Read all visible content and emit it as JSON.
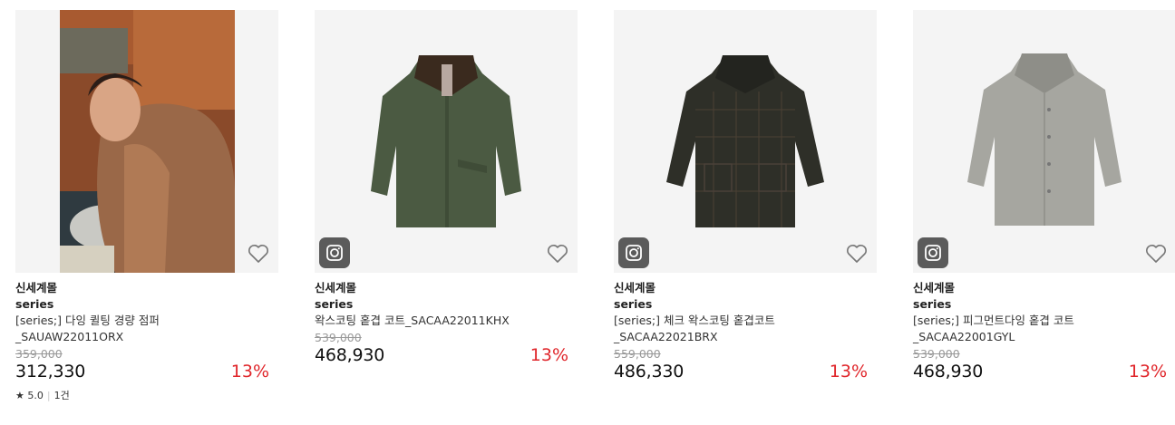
{
  "colors": {
    "discount": "#e0262b",
    "insta_badge": "#5b5b5b",
    "thumb_bg": "#f4f4f4"
  },
  "products": [
    {
      "store": "신세계몰",
      "brand": "series",
      "name_line1": "[series;] 다잉 퀼팅 경량 점퍼",
      "name_line2": "_SAUAW22011ORX",
      "original_price": "359,000",
      "price": "312,330",
      "discount": "13%",
      "rating_star": "★",
      "rating": "5.0",
      "review_count": "1건",
      "heart_icon": "heart-outline-icon"
    },
    {
      "store": "신세계몰",
      "brand": "series",
      "name_line1": "왁스코팅 홑겹 코트_SACAA22011KHX",
      "name_line2": "",
      "original_price": "539,000",
      "price": "468,930",
      "discount": "13%",
      "badge_icon": "instagram-icon",
      "heart_icon": "heart-outline-icon"
    },
    {
      "store": "신세계몰",
      "brand": "series",
      "name_line1": "[series;] 체크 왁스코팅 홑겹코트",
      "name_line2": "_SACAA22021BRX",
      "original_price": "559,000",
      "price": "486,330",
      "discount": "13%",
      "badge_icon": "instagram-icon",
      "heart_icon": "heart-outline-icon"
    },
    {
      "store": "신세계몰",
      "brand": "series",
      "name_line1": "[series;] 피그먼트다잉 홑겹 코트",
      "name_line2": "_SACAA22001GYL",
      "original_price": "539,000",
      "price": "468,930",
      "discount": "13%",
      "badge_icon": "instagram-icon",
      "heart_icon": "heart-outline-icon"
    }
  ]
}
